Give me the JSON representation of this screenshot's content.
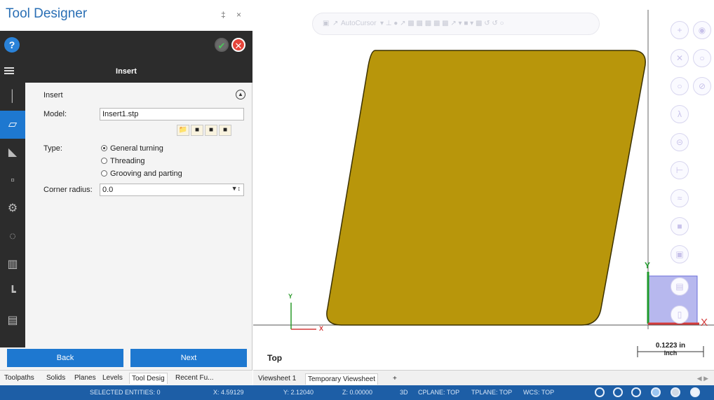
{
  "panel": {
    "title": "Tool Designer",
    "title_controls": "‡ ×",
    "page_title": "Insert",
    "side_buttons": [
      {
        "icon": "drill-tool-icon",
        "glyph": "│"
      },
      {
        "icon": "insert-shape-icon",
        "glyph": "▱"
      },
      {
        "icon": "holder-icon",
        "glyph": "◣"
      },
      {
        "icon": "assembly-icon",
        "glyph": "▫"
      },
      {
        "icon": "gear-icon",
        "glyph": "⚙"
      },
      {
        "icon": "circle-dashed-icon",
        "glyph": "◌"
      },
      {
        "icon": "machine-icon",
        "glyph": "▥"
      },
      {
        "icon": "setup-icon",
        "glyph": "┗"
      },
      {
        "icon": "summary-icon",
        "glyph": "▤"
      }
    ],
    "form": {
      "section_label": "Insert",
      "model_label": "Model:",
      "model_value": "Insert1.stp",
      "type_label": "Type:",
      "type_options": [
        "General turning",
        "Threading",
        "Grooving and parting"
      ],
      "type_selected": "General turning",
      "corner_radius_label": "Corner radius:",
      "corner_radius_value": "0.0"
    },
    "back_label": "Back",
    "next_label": "Next",
    "bottom_tabs": [
      "Toolpaths",
      "Solids",
      "Planes",
      "Levels",
      "Tool Desig",
      "Recent Fu..."
    ],
    "active_bottom_tab": "Tool Desig"
  },
  "viewport": {
    "view_name": "Top",
    "floating_toolbar_label": "AutoCursor",
    "axis_x_label": "X",
    "axis_y_label": "Y",
    "scale_value": "0.1223 in",
    "scale_unit": "Inch",
    "shape_color": "#b8960b",
    "shape_stroke": "#3a3000"
  },
  "viewsheet_tabs": [
    "Viewsheet 1",
    "Temporary Viewsheet",
    "+"
  ],
  "active_viewsheet": "Temporary Viewsheet",
  "status_bar": {
    "selected_entities": "SELECTED ENTITIES: 0",
    "x": "X:  4.59129",
    "y": "Y:  2.12040",
    "z": "Z:  0.00000",
    "mode": "3D",
    "cplane": "CPLANE: TOP",
    "tplane": "TPLANE: TOP",
    "wcs": "WCS: TOP"
  },
  "colors": {
    "accent": "#1e78d0",
    "status_bar": "#1d5ea6",
    "panel_dark": "#2c2c2c",
    "title_blue": "#2a6fb5"
  }
}
